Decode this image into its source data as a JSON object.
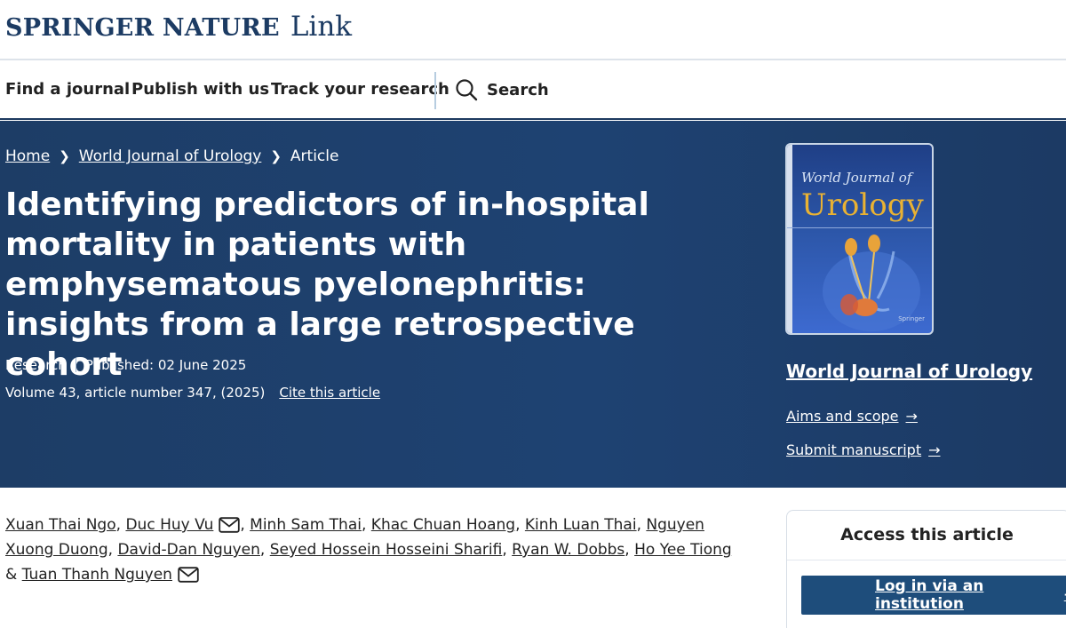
{
  "header": {
    "brand": "SPRINGER NATURE",
    "link": "Link"
  },
  "nav": {
    "find_journal": "Find a journal",
    "publish": "Publish with us",
    "track": "Track your research",
    "search": "Search"
  },
  "breadcrumb": {
    "home": "Home",
    "journal": "World Journal of Urology",
    "current": "Article"
  },
  "article": {
    "title": "Identifying predictors of in-hospital mortality in patients with emphysematous pyelonephritis: insights from a large retrospective cohort",
    "type": "Research",
    "published": "Published: 02 June 2025",
    "volume": "Volume 43, article number 347, (2025)",
    "cite": "Cite this article"
  },
  "journal": {
    "cover_title": "World Journal of",
    "cover_subtitle": "Urology",
    "cover_brand": "Springer",
    "name": "World Journal of Urology",
    "aims": "Aims and scope",
    "submit": "Submit manuscript"
  },
  "authors": [
    "Xuan Thai Ngo",
    "Duc Huy Vu",
    "Minh Sam Thai",
    "Khac Chuan Hoang",
    "Kinh Luan Thai",
    "Nguyen Xuong Duong",
    "David-Dan Nguyen",
    "Seyed Hossein Hosseini Sharifi",
    "Ryan W. Dobbs",
    "Ho Yee Tiong",
    "Tuan Thanh Nguyen"
  ],
  "authors_conjunction": "&",
  "access": {
    "title": "Access this article",
    "login": "Log in via an institution"
  },
  "icons": {
    "search": "search-icon",
    "mail": "mail-icon",
    "chevron": "chevron-right-icon",
    "arrow": "arrow-right-icon"
  },
  "colors": {
    "brand_navy": "#1c3b63",
    "hero_bg": "#1e4272",
    "button_bg": "#1e4d7b"
  }
}
